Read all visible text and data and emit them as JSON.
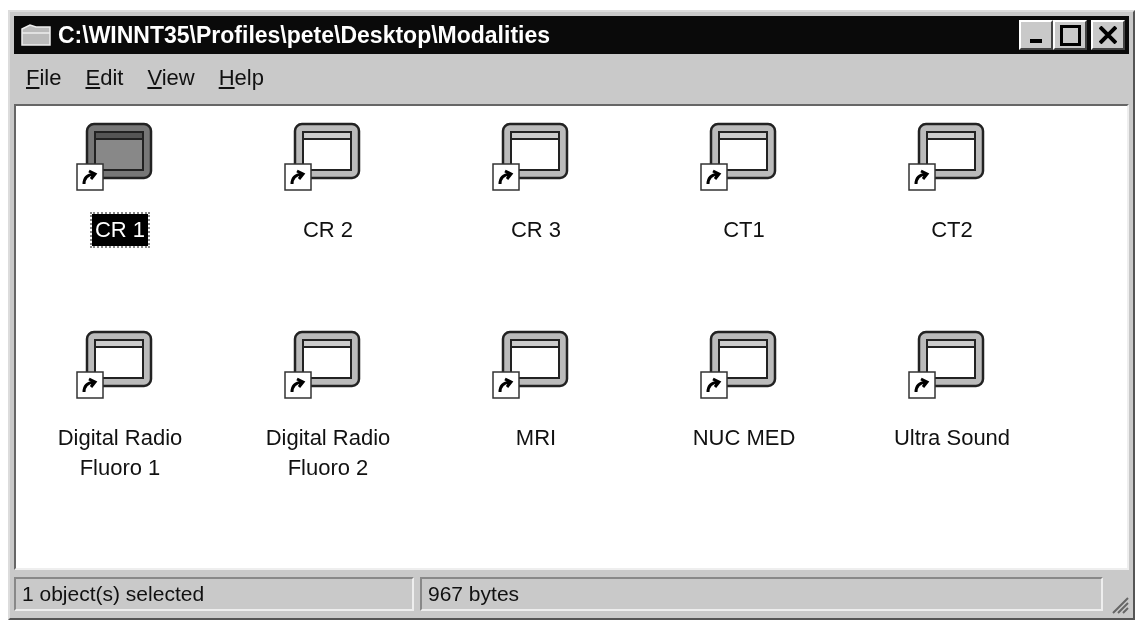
{
  "window": {
    "title": "C:\\WINNT35\\Profiles\\pete\\Desktop\\Modalities"
  },
  "menu": [
    {
      "label": "File"
    },
    {
      "label": "Edit"
    },
    {
      "label": "View"
    },
    {
      "label": "Help"
    }
  ],
  "items": [
    {
      "label": "CR 1",
      "selected": true
    },
    {
      "label": "CR 2",
      "selected": false
    },
    {
      "label": "CR 3",
      "selected": false
    },
    {
      "label": "CT1",
      "selected": false
    },
    {
      "label": "CT2",
      "selected": false
    },
    {
      "label": "Digital Radio Fluoro 1",
      "selected": false
    },
    {
      "label": "Digital Radio Fluoro 2",
      "selected": false
    },
    {
      "label": "MRI",
      "selected": false
    },
    {
      "label": "NUC MED",
      "selected": false
    },
    {
      "label": "Ultra Sound",
      "selected": false
    }
  ],
  "status_bar": [
    "1 object(s) selected",
    "967 bytes"
  ]
}
